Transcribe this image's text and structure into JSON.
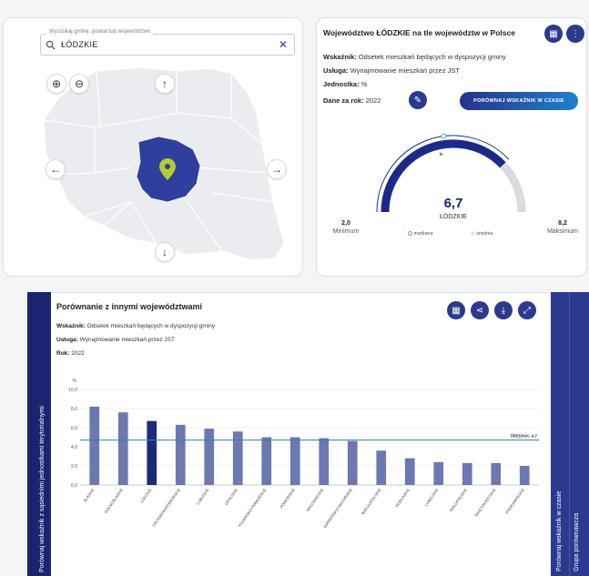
{
  "map": {
    "search_legend": "Wyszukaj gminę, powiat lub województwo",
    "search_value": "ŁÓDZKIE",
    "colors": {
      "region_fill": "#2f3f9e",
      "land_fill": "#ebecef",
      "border": "#ffffff",
      "pin": "#b5cc2e"
    }
  },
  "stats": {
    "title": "Województwo ŁÓDZKIE na tle województw w Polsce",
    "indicator_label": "Wskaźnik:",
    "indicator_value": "Odsetek mieszkań będących w dyspozycji gminy",
    "service_label": "Usługa:",
    "service_value": "Wynajmowanie mieszkań przez JST",
    "unit_label": "Jednostka:",
    "unit_value": "%",
    "year_label": "Dane za rok:",
    "year_value": "2022",
    "compare_time_button": "PORÓWNAJ WSKAŹNIK W CZASIE",
    "gauge": {
      "value_text": "6,7",
      "region": "ŁÓDZKIE",
      "min_value": "2,0",
      "min_label": "Minimum",
      "max_value": "8,2",
      "max_label": "Maksimum",
      "median_label": "mediana",
      "mean_label": "średnia",
      "value": 6.7,
      "min": 2.0,
      "max": 8.2,
      "median": 4.85,
      "mean": 4.7,
      "colors": {
        "fill": "#1b2a8a",
        "track": "#d9dadd"
      }
    }
  },
  "comparison": {
    "left_strip": "Porównaj wskaźnik z sąsiednimi jednostkami terytorialnymi",
    "right_strip_1": "Porównaj wskaźnik w czasie",
    "right_strip_2": "Grupa porównawcza",
    "title": "Porównanie z innymi województwami",
    "indicator_label": "Wskaźnik:",
    "indicator_value": "Odsetek mieszkań będących w dyspozycji gminy",
    "service_label": "Usługa:",
    "service_value": "Wynajmowanie mieszkań przez JST",
    "year_label": "Rok:",
    "year_value": "2022"
  },
  "chart_data": {
    "type": "bar",
    "ylabel": "%",
    "ylim": [
      0,
      10
    ],
    "yticks": [
      "0,0",
      "2,0",
      "4,0",
      "6,0",
      "8,0",
      "10,0"
    ],
    "categories": [
      "ŚLĄSKIE",
      "DOLNOŚLĄSKIE",
      "ŁÓDZKIE",
      "ZACHODNIOPOMORSKIE",
      "LUBUSKIE",
      "OPOLSKIE",
      "KUJAWSKO-POMORSKIE",
      "POMORSKIE",
      "MAZOWIECKIE",
      "WARMIŃSKO-MAZURSKIE",
      "WIELKOPOLSKIE",
      "PODLASKIE",
      "LUBELSKIE",
      "MAŁOPOLSKIE",
      "ŚWIĘTOKRZYSKIE",
      "PODKARPACKIE"
    ],
    "values": [
      8.2,
      7.6,
      6.7,
      6.3,
      5.9,
      5.6,
      5.0,
      5.0,
      4.9,
      4.6,
      3.6,
      2.8,
      2.4,
      2.3,
      2.3,
      2.0
    ],
    "highlight": "ŁÓDZKIE",
    "mean": 4.7,
    "mean_label": "ŚREDNIA: 4,7",
    "grid": true,
    "colors": {
      "bar": "#6b79b0",
      "highlight": "#1d2a7a",
      "mean_line": "#2a7fb8"
    }
  }
}
